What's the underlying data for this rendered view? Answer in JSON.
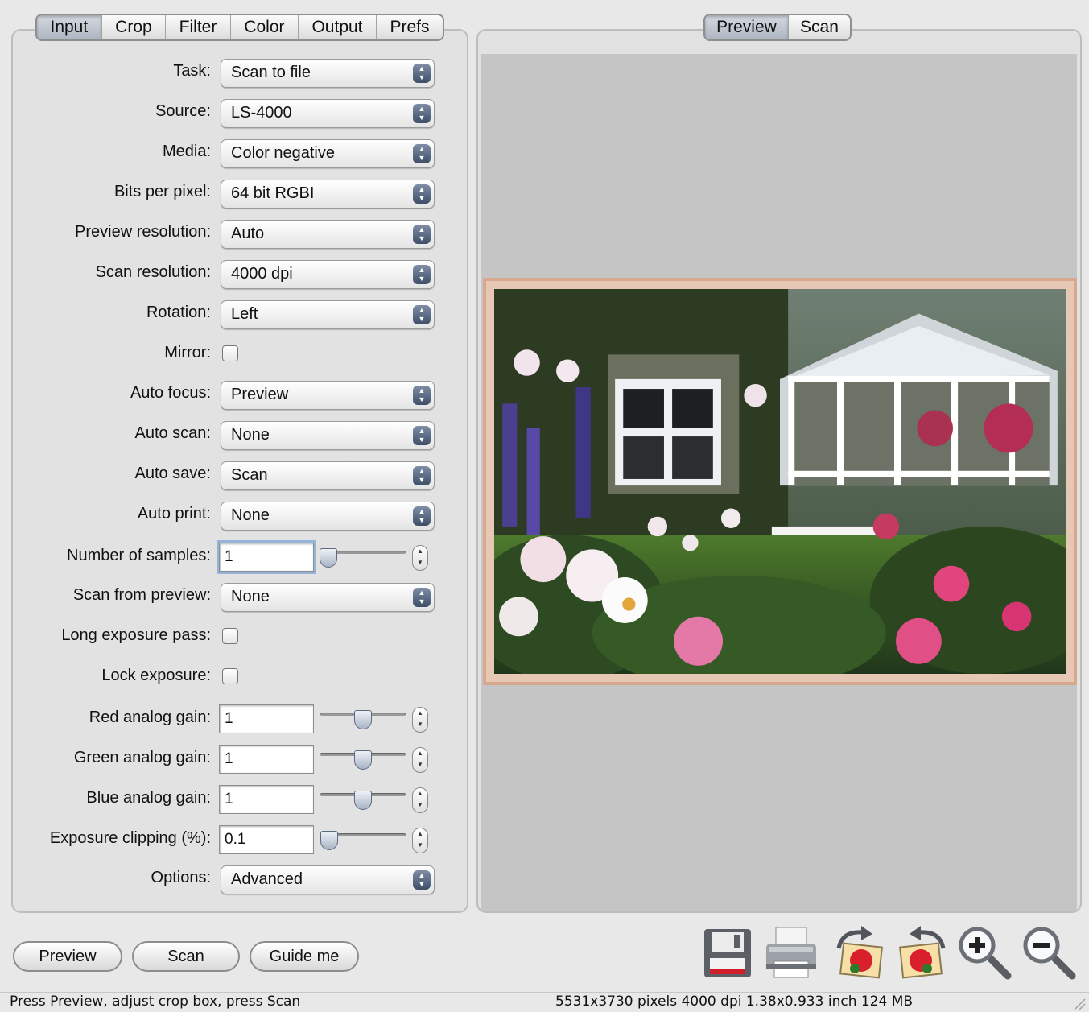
{
  "left_tabs": [
    "Input",
    "Crop",
    "Filter",
    "Color",
    "Output",
    "Prefs"
  ],
  "right_tabs": [
    "Preview",
    "Scan"
  ],
  "fields": {
    "task": {
      "label": "Task:",
      "value": "Scan to file"
    },
    "source": {
      "label": "Source:",
      "value": "LS-4000"
    },
    "media": {
      "label": "Media:",
      "value": "Color negative"
    },
    "bits": {
      "label": "Bits per pixel:",
      "value": "64 bit RGBI"
    },
    "preview_res": {
      "label": "Preview resolution:",
      "value": "Auto"
    },
    "scan_res": {
      "label": "Scan resolution:",
      "value": "4000 dpi"
    },
    "rotation": {
      "label": "Rotation:",
      "value": "Left"
    },
    "mirror": {
      "label": "Mirror:",
      "checked": false
    },
    "auto_focus": {
      "label": "Auto focus:",
      "value": "Preview"
    },
    "auto_scan": {
      "label": "Auto scan:",
      "value": "None"
    },
    "auto_save": {
      "label": "Auto save:",
      "value": "Scan"
    },
    "auto_print": {
      "label": "Auto print:",
      "value": "None"
    },
    "samples": {
      "label": "Number of samples:",
      "value": "1",
      "slider_fraction": 0.09
    },
    "scan_from_preview": {
      "label": "Scan from preview:",
      "value": "None"
    },
    "long_exposure": {
      "label": "Long exposure pass:",
      "checked": false
    },
    "lock_exposure": {
      "label": "Lock exposure:",
      "checked": false
    },
    "red_gain": {
      "label": "Red analog gain:",
      "value": "1",
      "slider_fraction": 0.5
    },
    "green_gain": {
      "label": "Green analog gain:",
      "value": "1",
      "slider_fraction": 0.5
    },
    "blue_gain": {
      "label": "Blue analog gain:",
      "value": "1",
      "slider_fraction": 0.5
    },
    "exposure_clip": {
      "label": "Exposure clipping (%):",
      "value": "0.1",
      "slider_fraction": 0.1
    },
    "options": {
      "label": "Options:",
      "value": "Advanced"
    }
  },
  "buttons": {
    "preview": "Preview",
    "scan": "Scan",
    "guide": "Guide me"
  },
  "tool_icons": [
    "save-icon",
    "print-icon",
    "rotate-right-icon",
    "rotate-left-icon",
    "zoom-in-icon",
    "zoom-out-icon"
  ],
  "status": {
    "hint": "Press Preview, adjust crop box, press Scan",
    "info": "5531x3730 pixels 4000 dpi 1.38x0.933 inch 124 MB"
  }
}
